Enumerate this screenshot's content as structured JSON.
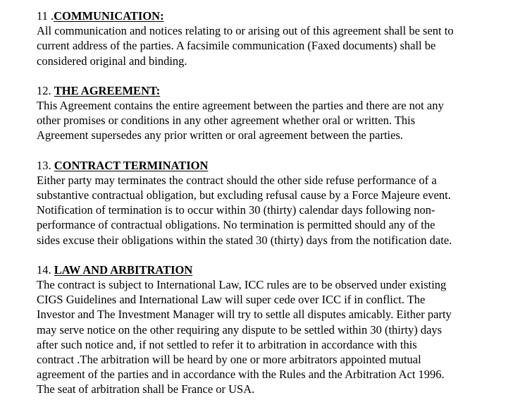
{
  "sections": [
    {
      "number": "11 .",
      "title": "COMMUNICATION:",
      "lines": [
        "All communication and notices relating to or arising out of this agreement shall be sent to",
        "current address of the parties. A facsimile communication (Faxed documents) shall be",
        "considered original and binding."
      ]
    },
    {
      "number": "12. ",
      "title": "THE AGREEMENT:",
      "lines": [
        "This Agreement contains the entire agreement between the parties and there are not any",
        "other promises or conditions in any other agreement whether oral or written. This",
        "Agreement supersedes any prior written or oral agreement between the parties."
      ]
    },
    {
      "number": "13. ",
      "title": "CONTRACT TERMINATION",
      "lines": [
        "Either party may terminates the contract should the other side refuse performance of a",
        "substantive contractual obligation, but excluding refusal cause by a Force Majeure event.",
        "Notification of termination is to occur within 30 (thirty) calendar days following non-",
        "performance of contractual obligations. No termination is permitted should any of the",
        "sides excuse their obligations within the stated 30 (thirty) days from the notification date."
      ]
    },
    {
      "number": "14. ",
      "title": "LAW AND ARBITRATION",
      "lines": [
        "The contract is subject to International Law, ICC rules are to be observed under existing",
        "CIGS Guidelines and International Law will super cede over ICC if in conflict. The",
        "Investor and The Investment Manager will try to settle all disputes amicably. Either party",
        "may serve notice on the other requiring any dispute to be settled within 30 (thirty) days",
        "after such notice and, if not settled to refer it to arbitration in accordance with this",
        "contract .The arbitration will be heard by one or more arbitrators appointed mutual",
        "agreement of the parties and in accordance with the Rules and the Arbitration Act 1996.",
        "The seat of arbitration shall be France or USA."
      ]
    }
  ]
}
